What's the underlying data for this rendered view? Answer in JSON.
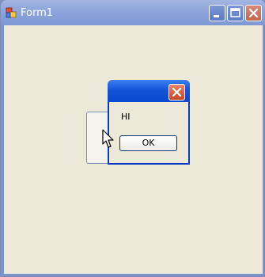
{
  "window": {
    "title": "Form1",
    "icons": [
      "app-icon",
      "minimize-icon",
      "maximize-icon",
      "close-icon"
    ],
    "colors": {
      "titlebar": "#8EA6DB",
      "client": "#ECE9D8",
      "close": "#C2664F"
    }
  },
  "dialog": {
    "message": "HI",
    "ok_label": "OK",
    "icons": [
      "close-icon"
    ],
    "colors": {
      "titlebar": "#1653D8",
      "close": "#CC4424"
    }
  },
  "cursor": {
    "icon": "arrow-cursor-icon"
  }
}
